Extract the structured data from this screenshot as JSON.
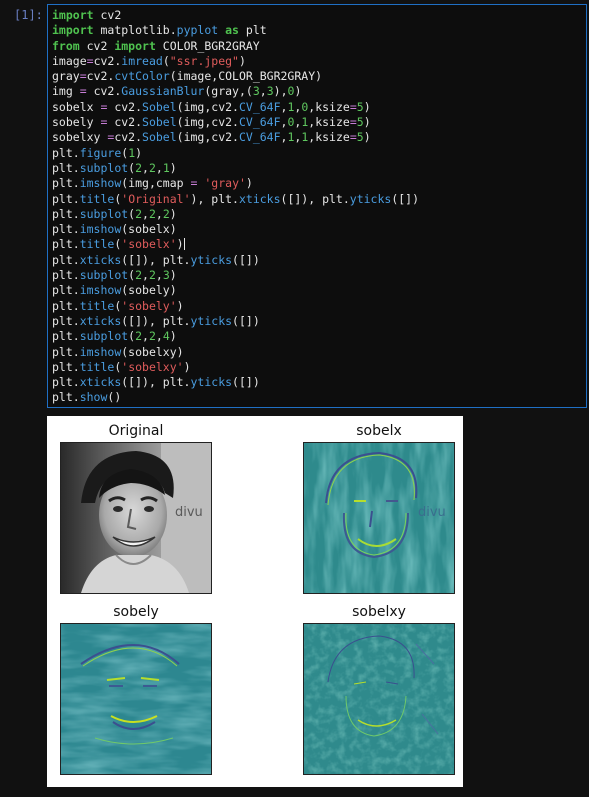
{
  "cell": {
    "prompt": "[1]:",
    "lines": [
      "import cv2",
      "import matplotlib.pyplot as plt",
      "from cv2 import COLOR_BGR2GRAY",
      "image=cv2.imread(\"ssr.jpeg\")",
      "gray=cv2.cvtColor(image,COLOR_BGR2GRAY)",
      "img = cv2.GaussianBlur(gray,(3,3),0)",
      "sobelx = cv2.Sobel(img,cv2.CV_64F,1,0,ksize=5)",
      "sobely = cv2.Sobel(img,cv2.CV_64F,0,1,ksize=5)",
      "sobelxy =cv2.Sobel(img,cv2.CV_64F,1,1,ksize=5)",
      "plt.figure(1)",
      "plt.subplot(2,2,1)",
      "plt.imshow(img,cmap = 'gray')",
      "plt.title('Original'), plt.xticks([]), plt.yticks([])",
      "plt.subplot(2,2,2)",
      "plt.imshow(sobelx)",
      "plt.title('sobelx')",
      "plt.xticks([]), plt.yticks([])",
      "plt.subplot(2,2,3)",
      "plt.imshow(sobely)",
      "plt.title('sobely')",
      "plt.xticks([]), plt.yticks([])",
      "plt.subplot(2,2,4)",
      "plt.imshow(sobelxy)",
      "plt.title('sobelxy')",
      "plt.xticks([]), plt.yticks([])",
      "plt.show()"
    ]
  },
  "output": {
    "titles": [
      "Original",
      "sobelx",
      "sobely",
      "sobelxy"
    ],
    "watermark_text": "divu",
    "colors": {
      "viridis_mid": "#2f8a8c",
      "viridis_low": "#3b4f8f",
      "viridis_high": "#b6de2b",
      "cell_border": "#1f6fc4",
      "keyword": "#4fc24f",
      "function": "#4a9de0",
      "string": "#e05c5c"
    }
  }
}
